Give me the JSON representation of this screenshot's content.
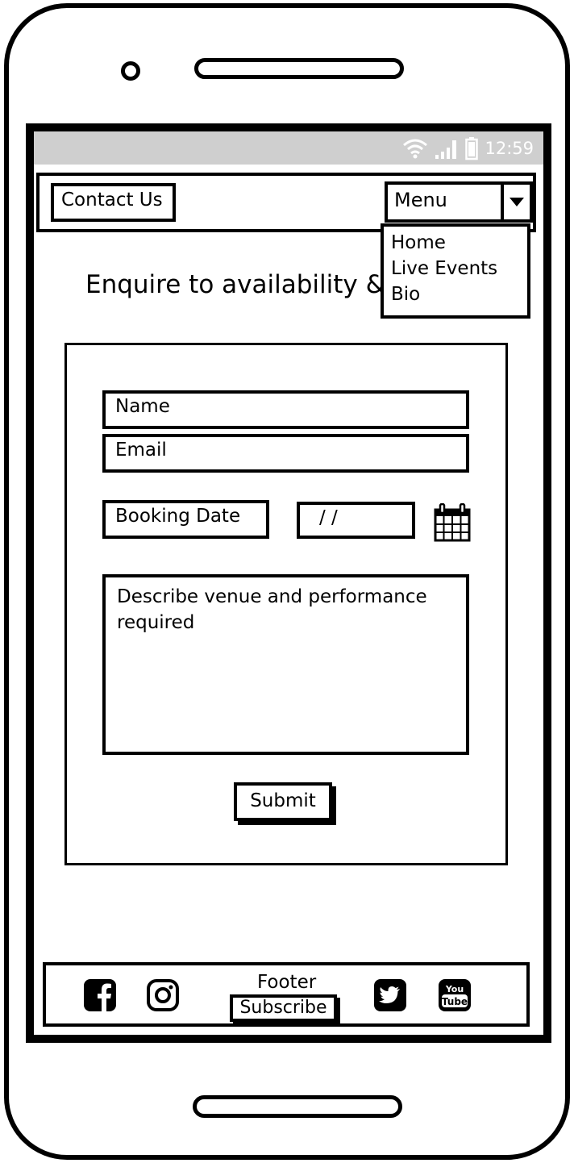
{
  "status_bar": {
    "time": "12:59"
  },
  "header": {
    "contact_label": "Contact Us",
    "menu_label": "Menu",
    "menu_items": [
      "Home",
      "Live Events",
      "Bio"
    ]
  },
  "page": {
    "heading": "Enquire to availability &"
  },
  "form": {
    "name_placeholder": "Name",
    "email_placeholder": "Email",
    "booking_date_label": "Booking Date",
    "date_value": "/  /",
    "description_placeholder": "Describe venue and performance required",
    "submit_label": "Submit"
  },
  "footer": {
    "title": "Footer",
    "subscribe_label": "Subscribe",
    "icons": [
      "facebook-icon",
      "instagram-icon",
      "twitter-icon",
      "youtube-icon"
    ]
  },
  "colors": {
    "status_bar": "#cfcfcf",
    "ink": "#000000",
    "background": "#ffffff"
  }
}
